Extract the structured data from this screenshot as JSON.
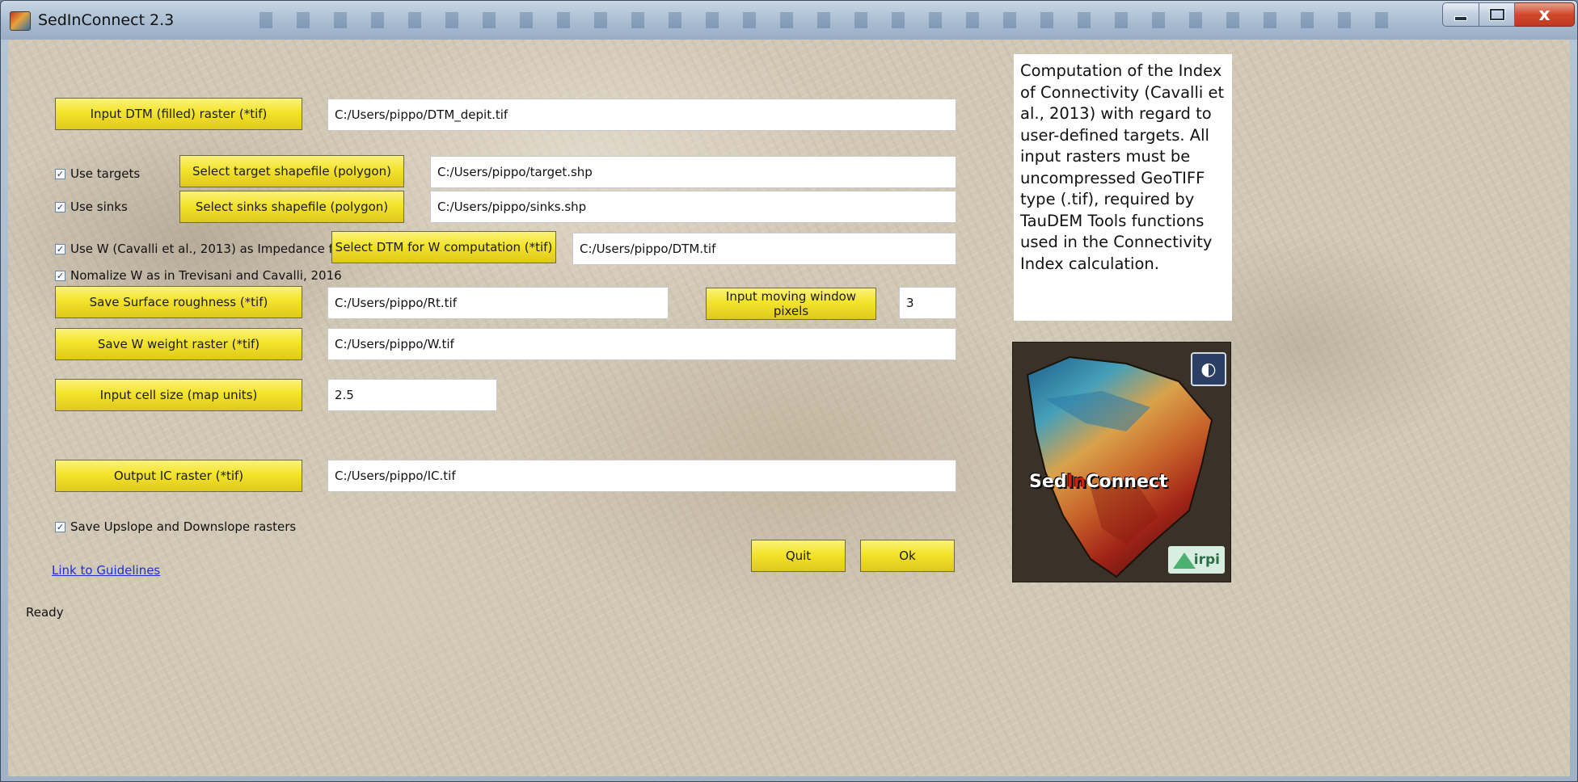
{
  "window": {
    "title": "SedInConnect 2.3",
    "close_glyph": "x"
  },
  "inputs": {
    "dtm_button": "Input DTM (filled) raster (*tif)",
    "dtm_value": "C:/Users/pippo/DTM_depit.tif",
    "targets_checkbox": "Use targets",
    "targets_button": "Select target shapefile (polygon)",
    "targets_value": "C:/Users/pippo/target.shp",
    "sinks_checkbox": "Use sinks",
    "sinks_button": "Select sinks shapefile (polygon)",
    "sinks_value": "C:/Users/pippo/sinks.shp",
    "use_w_checkbox": "Use W (Cavalli et al., 2013) as Impedance f.",
    "w_dtm_button": "Select DTM for W computation (*tif)",
    "w_dtm_value": "C:/Users/pippo/DTM.tif",
    "normalize_checkbox": "Nomalize W as in Trevisani and Cavalli, 2016",
    "roughness_button": "Save Surface roughness (*tif)",
    "roughness_value": "C:/Users/pippo/Rt.tif",
    "window_button": "Input moving window pixels",
    "window_value": "3",
    "w_weight_button": "Save W weight raster (*tif)",
    "w_weight_value": "C:/Users/pippo/W.tif",
    "cellsize_button": "Input cell size (map units)",
    "cellsize_value": "2.5",
    "output_button": "Output IC raster (*tif)",
    "output_value": "C:/Users/pippo/IC.tif",
    "updown_checkbox": "Save Upslope and Downslope rasters"
  },
  "footer": {
    "guidelines_link": "Link to Guidelines",
    "quit_button": "Quit",
    "ok_button": "Ok",
    "status": "Ready"
  },
  "description": "Computation of the Index of Connectivity (Cavalli et al., 2013) with regard to user-defined targets. All input rasters must be uncompressed GeoTIFF type (.tif), required by TauDEM Tools functions used in the Connectivity Index calculation.",
  "logo": {
    "name_part1": "Sed",
    "name_part2": "In",
    "name_part3": "Connect",
    "partner_left": "irpi"
  },
  "checkboxes_checked": {
    "targets": true,
    "sinks": true,
    "use_w": true,
    "normalize": true,
    "updown": true
  },
  "colors": {
    "button_yellow": "#f3e42a",
    "link_blue": "#1c2fd8",
    "logo_red": "#d01f13"
  }
}
